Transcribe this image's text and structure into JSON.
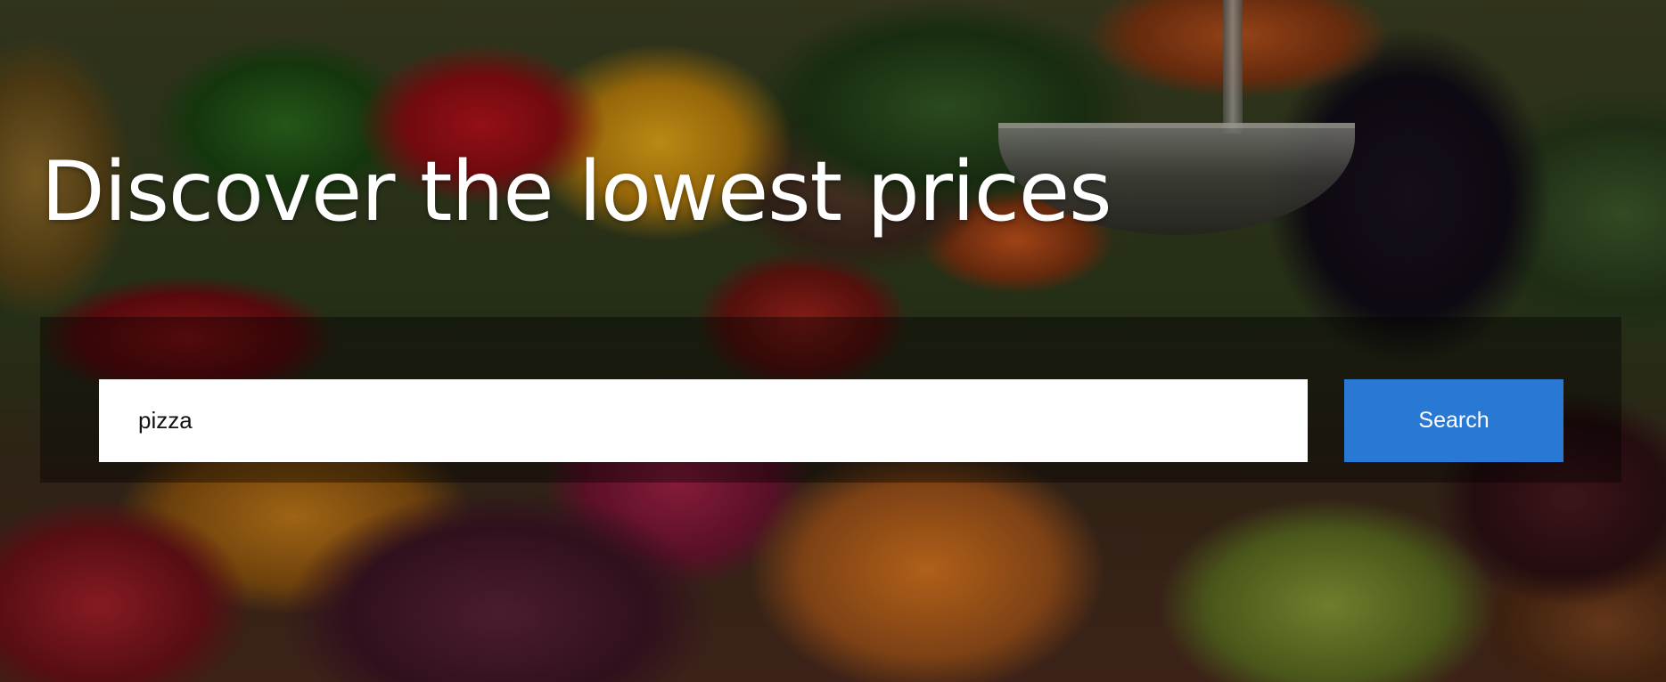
{
  "hero": {
    "headline": "Discover the lowest prices",
    "background": "produce-market-photo"
  },
  "search": {
    "value": "pizza",
    "button_label": "Search",
    "button_color": "#2878d4"
  }
}
